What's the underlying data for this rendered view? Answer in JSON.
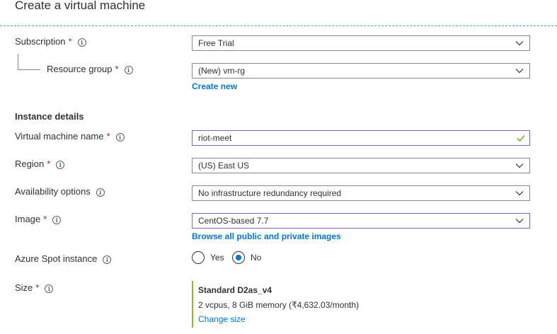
{
  "page": {
    "title": "Create a virtual machine"
  },
  "subscription": {
    "label": "Subscription",
    "required_mark": "*",
    "value": "Free Trial"
  },
  "resource_group": {
    "label": "Resource group",
    "required_mark": "*",
    "value": "(New) vm-rg",
    "create_new_link": "Create new"
  },
  "instance_details": {
    "heading": "Instance details",
    "vm_name": {
      "label": "Virtual machine name",
      "required_mark": "*",
      "value": "riot-meet",
      "valid": true
    },
    "region": {
      "label": "Region",
      "required_mark": "*",
      "value": "(US) East US"
    },
    "availability": {
      "label": "Availability options",
      "value": "No infrastructure redundancy required"
    },
    "image": {
      "label": "Image",
      "required_mark": "*",
      "value": "CentOS-based 7.7",
      "browse_link": "Browse all public and private images"
    },
    "spot": {
      "label": "Azure Spot instance",
      "options": [
        "Yes",
        "No"
      ],
      "selected": "No"
    },
    "size": {
      "label": "Size",
      "required_mark": "*",
      "name": "Standard D2as_v4",
      "description": "2 vcpus, 8 GiB memory (₹4,632.03/month)",
      "change_link": "Change size"
    }
  },
  "colors": {
    "link": "#0078d4",
    "required": "#a4262c",
    "focus_border": "#8764b8",
    "valid_check": "#57a300",
    "size_accent": "#8cbd18",
    "divider": "#4aa8c9"
  },
  "icons": {
    "info": "info-icon",
    "dropdown": "chevron-down-icon",
    "valid": "checkmark-icon"
  }
}
